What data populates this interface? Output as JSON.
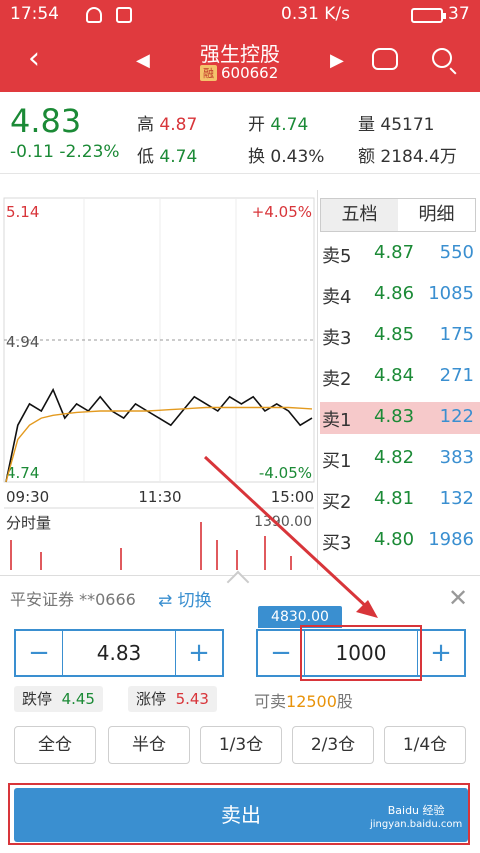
{
  "status_bar": {
    "time": "17:54",
    "net_speed": "0.31 K/s",
    "battery": "37"
  },
  "title_bar": {
    "name": "强生控股",
    "code": "600662",
    "margin_badge": "融"
  },
  "quote": {
    "price": "4.83",
    "change": "-0.11",
    "change_pct": "-2.23%",
    "high_label": "高",
    "high": "4.87",
    "low_label": "低",
    "low": "4.74",
    "open_label": "开",
    "open": "4.74",
    "turnover_label": "换",
    "turnover": "0.43%",
    "volume_label": "量",
    "volume": "45171",
    "amount_label": "额",
    "amount": "2184.4万"
  },
  "chart": {
    "top_price": "5.14",
    "top_pct": "+4.05%",
    "mid_price": "4.94",
    "bottom_price": "4.74",
    "bottom_pct": "-4.05%",
    "time_start": "09:30",
    "time_mid": "11:30",
    "time_end": "15:00",
    "volume_label": "分时量",
    "volume_max": "1390.00"
  },
  "chart_data": {
    "type": "line",
    "ylim": [
      4.74,
      5.14
    ],
    "reference": 4.94,
    "series": [
      {
        "values": [
          4.74,
          4.82,
          4.85,
          4.84,
          4.87,
          4.83,
          4.85,
          4.84,
          4.86,
          4.84,
          4.83,
          4.85,
          4.84,
          4.83,
          4.82,
          4.84,
          4.86,
          4.85,
          4.84,
          4.86,
          4.85,
          4.86,
          4.84,
          4.85,
          4.84,
          4.82,
          4.83
        ]
      },
      {
        "values": [
          4.74,
          4.8,
          4.82,
          4.83,
          4.834,
          4.836,
          4.838,
          4.839,
          4.84,
          4.84,
          4.84,
          4.84,
          4.84,
          4.841,
          4.842,
          4.843,
          4.844,
          4.845,
          4.845,
          4.845,
          4.845,
          4.845,
          4.845,
          4.845,
          4.845,
          4.844,
          4.843
        ]
      }
    ]
  },
  "order_book": {
    "tabs": [
      "五档",
      "明细"
    ],
    "rows": [
      {
        "label": "卖5",
        "price": "4.87",
        "volume": "550"
      },
      {
        "label": "卖4",
        "price": "4.86",
        "volume": "1085"
      },
      {
        "label": "卖3",
        "price": "4.85",
        "volume": "175"
      },
      {
        "label": "卖2",
        "price": "4.84",
        "volume": "271"
      },
      {
        "label": "卖1",
        "price": "4.83",
        "volume": "122"
      },
      {
        "label": "买1",
        "price": "4.82",
        "volume": "383"
      },
      {
        "label": "买2",
        "price": "4.81",
        "volume": "132"
      },
      {
        "label": "买3",
        "price": "4.80",
        "volume": "1986"
      }
    ]
  },
  "trade": {
    "account": "平安证券 **0666",
    "switch_label": "切换",
    "price_value": "4.83",
    "amount_tag": "4830.00",
    "qty_value": "1000",
    "limit_down_label": "跌停",
    "limit_down": "4.45",
    "limit_up_label": "涨停",
    "limit_up": "5.43",
    "sellable_prefix": "可卖",
    "sellable_qty": "12500",
    "sellable_suffix": "股",
    "ratios": [
      "全仓",
      "半仓",
      "1/3仓",
      "2/3仓",
      "1/4仓"
    ],
    "sell_label": "卖出"
  },
  "watermark": {
    "line1": "Baidu 经验",
    "line2": "jingyan.baidu.com"
  },
  "colors": {
    "brand_red": "#e03a3e",
    "accent_blue": "#3a8fd0",
    "up_red": "#d8353a",
    "down_green": "#1b8a36"
  }
}
